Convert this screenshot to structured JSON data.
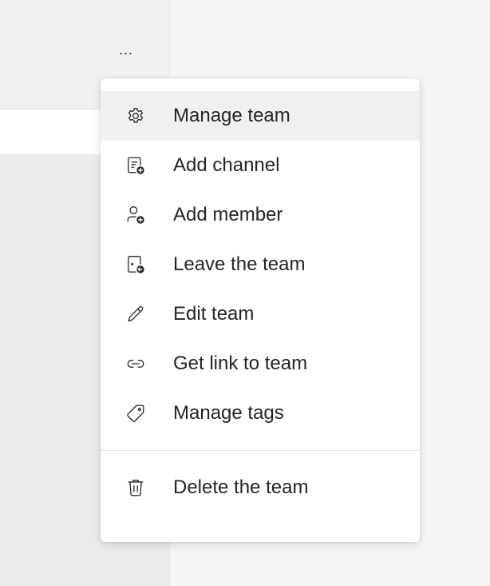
{
  "header": {
    "more_label": "..."
  },
  "menu": {
    "items": [
      {
        "label": "Manage team",
        "icon": "gear-icon"
      },
      {
        "label": "Add channel",
        "icon": "add-channel-icon"
      },
      {
        "label": "Add member",
        "icon": "add-member-icon"
      },
      {
        "label": "Leave the team",
        "icon": "leave-team-icon"
      },
      {
        "label": "Edit team",
        "icon": "pencil-icon"
      },
      {
        "label": "Get link to team",
        "icon": "link-icon"
      },
      {
        "label": "Manage tags",
        "icon": "tag-icon"
      }
    ],
    "delete_item": {
      "label": "Delete the team",
      "icon": "trash-icon"
    }
  },
  "colors": {
    "text": "#242424",
    "menu_background": "#ffffff",
    "hover_background": "#f0f0f0",
    "accent_dark": "#242424"
  }
}
